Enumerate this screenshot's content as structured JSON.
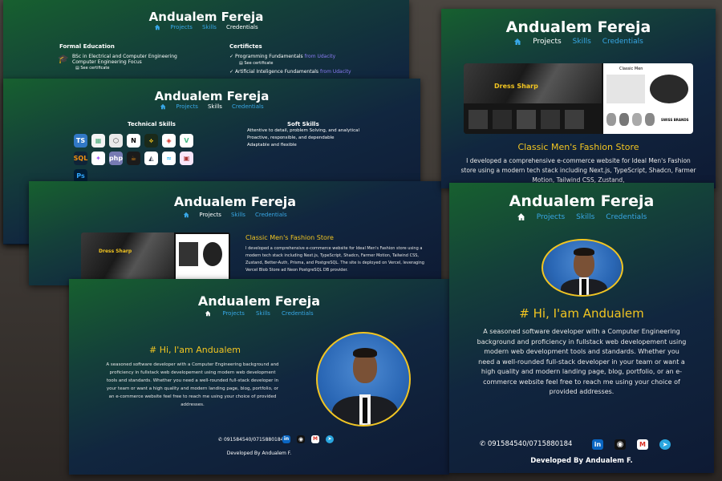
{
  "site": {
    "name": "Andualem Fereja",
    "nav": {
      "projects": "Projects",
      "skills": "Skills",
      "credentials": "Credentials"
    }
  },
  "credentials": {
    "formal_heading": "Formal Education",
    "degree": "BSc in Electrical and Computer Engineering",
    "focus": "Computer Engineering Focus",
    "see_certificate": "See certificate",
    "cert_heading": "Certifictes",
    "certs": [
      {
        "name": "Programming Fundamentals",
        "from": "from Udacity"
      },
      {
        "name": "Artificial Inteligence Fundamentals",
        "from": "from Udacity"
      }
    ]
  },
  "skills": {
    "tech_heading": "Technical Skills",
    "soft_heading": "Soft Skills",
    "soft_items": [
      "Attentive to detail, problem Solving, and analytical",
      "Proactive, responsible, and dependable",
      "Adaptable and flexible"
    ],
    "tech_icons": [
      {
        "icon": "typescript-icon",
        "text": "TS",
        "bg": "#3178c6",
        "fg": "#ffffff"
      },
      {
        "icon": "tools-icon",
        "text": "▦",
        "bg": "#f4f4f4",
        "fg": "#4a7"
      },
      {
        "icon": "framer-icon",
        "text": "⬡",
        "bg": "#e9e9e9",
        "fg": "#333"
      },
      {
        "icon": "nextjs-icon",
        "text": "N",
        "bg": "#ffffff",
        "fg": "#000000"
      },
      {
        "icon": "python-icon",
        "text": "⟡",
        "bg": "#1a2a1a",
        "fg": "#f2c521"
      },
      {
        "icon": "redis-icon",
        "text": "◈",
        "bg": "#ffffff",
        "fg": "#d82c20"
      },
      {
        "icon": "vue-icon",
        "text": "V",
        "bg": "#ffffff",
        "fg": "#41b883"
      },
      {
        "icon": "mysql-icon",
        "text": "SQL",
        "bg": "#0f2438",
        "fg": "#f29111"
      },
      {
        "icon": "figma-icon",
        "text": "✦",
        "bg": "#ffffff",
        "fg": "#a259ff"
      },
      {
        "icon": "php-icon",
        "text": "php",
        "bg": "#777bb3",
        "fg": "#ffffff"
      },
      {
        "icon": "java-icon",
        "text": "☕",
        "bg": "#1b1b1b",
        "fg": "#f29111"
      },
      {
        "icon": "prisma-icon",
        "text": "◭",
        "bg": "#ffffff",
        "fg": "#2d3748"
      },
      {
        "icon": "tailwind-icon",
        "text": "≈",
        "bg": "#ffffff",
        "fg": "#38bdf8"
      },
      {
        "icon": "xd-icon",
        "text": "▣",
        "bg": "#f9e6fa",
        "fg": "#a33"
      },
      {
        "icon": "photoshop-icon",
        "text": "Ps",
        "bg": "#001e36",
        "fg": "#31a8ff"
      }
    ]
  },
  "project": {
    "title": "Classic Men's Fashion Store",
    "description": "I developed a comprehensive e-commerce website for Ideal Men's Fashion store using a modern tech stack including Next.js, TypeScript, Shadcn, Farmer Motion, Tailwind CSS, Zustand, Better-Auth, Prisma, and PostgreSQL. The site is deployed on Vercel, leveraging Vercel Blob Store ad Neon PostgreSQL DB provider.",
    "description_large": "I developed a comprehensive e-commerce website for Ideal Men's Fashion store using a modern tech stack including Next.js, TypeScript, Shadcn, Farmer Motion, Tailwind CSS, Zustand,",
    "shop_label": "Dress Sharp",
    "shop_label2": "Classic Men",
    "store_footer": "SWISS BRANDS"
  },
  "home": {
    "greeting": "# Hi, I'am Andualem",
    "bio": "A seasoned software developer with a Computer Engineering background and proficiency in fullstack web developement using modern web development tools and standards. Whether you need a well-rounded full-stack developer in your team or want a high quality and modern landing page, blog, portfolio, or an e-commerce website feel free to reach me using your choice of provided addresses.",
    "phone": "091584540/0715880184",
    "footer": "Developed By Andualem F.",
    "social": [
      {
        "icon": "linkedin-icon",
        "text": "in",
        "bg": "#0a66c2"
      },
      {
        "icon": "github-icon",
        "text": "◉",
        "bg": "#111111"
      },
      {
        "icon": "gmail-icon",
        "text": "M",
        "bg": "#ffffff"
      },
      {
        "icon": "telegram-icon",
        "text": "➤",
        "bg": "#2aa6df"
      }
    ]
  }
}
